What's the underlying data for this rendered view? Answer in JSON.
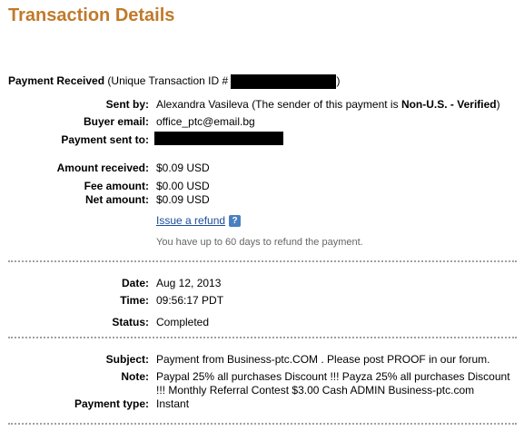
{
  "page_title": "Transaction Details",
  "payment": {
    "received_label": "Payment Received",
    "unique_prefix": "(Unique Transaction ID #",
    "unique_suffix": ")"
  },
  "sender": {
    "label": "Sent by:",
    "name": "Alexandra Vasileva",
    "note_prefix": "(The sender of this payment is ",
    "status": "Non-U.S. - Verified",
    "note_suffix": ")"
  },
  "buyer_email": {
    "label": "Buyer email:",
    "value": "office_ptc@email.bg"
  },
  "payment_sent_to": {
    "label": "Payment sent to:"
  },
  "amounts": {
    "received_label": "Amount received:",
    "received": "$0.09 USD",
    "fee_label": "Fee amount:",
    "fee": "$0.00 USD",
    "net_label": "Net amount:",
    "net": "$0.09 USD"
  },
  "refund": {
    "link": "Issue a refund",
    "help_icon": "question-icon",
    "help_glyph": "?",
    "note": "You have up to 60 days to refund the payment."
  },
  "details": {
    "date_label": "Date:",
    "date": "Aug 12, 2013",
    "time_label": "Time:",
    "time": "09:56:17 PDT",
    "status_label": "Status:",
    "status": "Completed"
  },
  "message": {
    "subject_label": "Subject:",
    "subject": "Payment from Business-ptc.COM . Please post PROOF in our forum.",
    "note_label": "Note:",
    "note_line1": "Paypal 25% all purchases Discount !!! Payza 25% all purchases Discount",
    "note_line2": "!!! Monthly Referral Contest $3.00 Cash ADMIN Business-ptc.com",
    "type_label": "Payment type:",
    "type": "Instant"
  },
  "colors": {
    "title": "#c07a2b",
    "link": "#1a4d9c",
    "help": "#4a7fc0"
  }
}
